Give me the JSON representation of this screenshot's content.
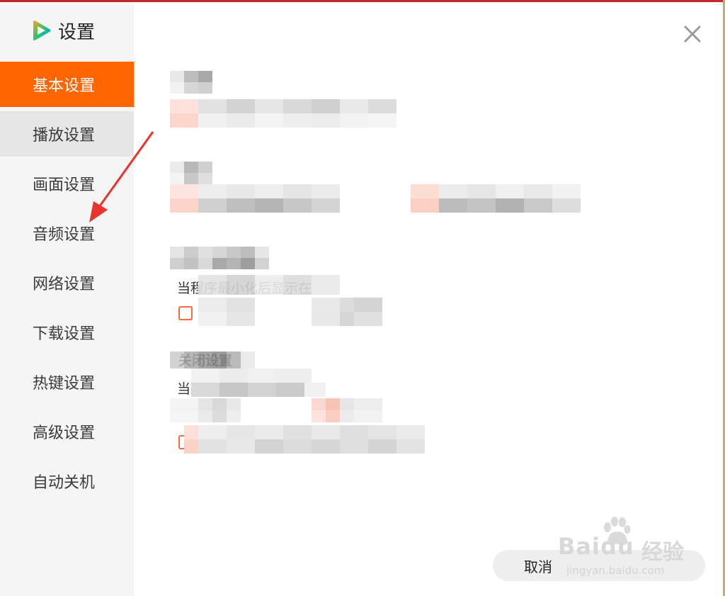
{
  "window": {
    "title": "设置"
  },
  "colors": {
    "accent": "#ff6600",
    "sidebar_bg": "#f5f5f5",
    "hover_bg": "#e6e6e6",
    "check_border": "#ff6a3d",
    "annotation_arrow": "#e8342c"
  },
  "sidebar": {
    "items": [
      {
        "label": "基本设置",
        "state": "active"
      },
      {
        "label": "播放设置",
        "state": "hover"
      },
      {
        "label": "画面设置",
        "state": "normal"
      },
      {
        "label": "音频设置",
        "state": "normal"
      },
      {
        "label": "网络设置",
        "state": "normal"
      },
      {
        "label": "下载设置",
        "state": "normal"
      },
      {
        "label": "热键设置",
        "state": "normal"
      },
      {
        "label": "高级设置",
        "state": "normal"
      },
      {
        "label": "自动关机",
        "state": "normal"
      }
    ]
  },
  "main": {
    "close_icon": "close-icon",
    "sections": {
      "close_settings_heading": "关闭设置",
      "close_behavior_text": "当",
      "window_behavior_text": "当程序最小化后显示在"
    }
  },
  "footer": {
    "cancel_label": "取消"
  },
  "watermark": {
    "logo": "Baidu",
    "text": "经验",
    "url": "jingyan.baidu.com"
  }
}
